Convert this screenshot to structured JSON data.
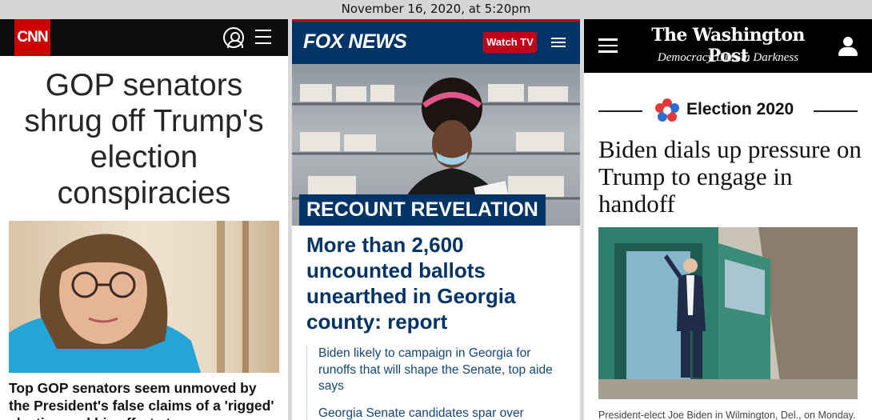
{
  "screenshot_date": "November 16, 2020, at 5:20pm",
  "cnn": {
    "logo": "CNN",
    "headline": "GOP senators shrug off Trump's election conspiracies",
    "caption": "Top GOP senators seem unmoved by the President's false claims of a 'rigged' election and his efforts to sow"
  },
  "fox": {
    "logo": "FOX NEWS",
    "watch_label": "Watch TV",
    "kicker": "RECOUNT REVELATION",
    "headline": "More than 2,600 uncounted ballots unearthed in Georgia county: report",
    "related": [
      "Biden likely to campaign in Georgia for runoffs that will shape the Senate, top aide says",
      "Georgia Senate candidates spar over"
    ]
  },
  "wapo": {
    "logo": "The Washington Post",
    "tagline": "Democracy Dies in Darkness",
    "kicker": "Election 2020",
    "headline": "Biden dials up pressure on Trump to engage in handoff",
    "caption": "President-elect Joe Biden in Wilmington, Del., on Monday."
  },
  "colors": {
    "cnn_red": "#cc0000",
    "fox_navy": "#003366",
    "fox_red": "#c20017",
    "wapo_black": "#000000"
  },
  "icons": [
    "user-icon",
    "hamburger-menu-icon",
    "election-star-icon"
  ]
}
